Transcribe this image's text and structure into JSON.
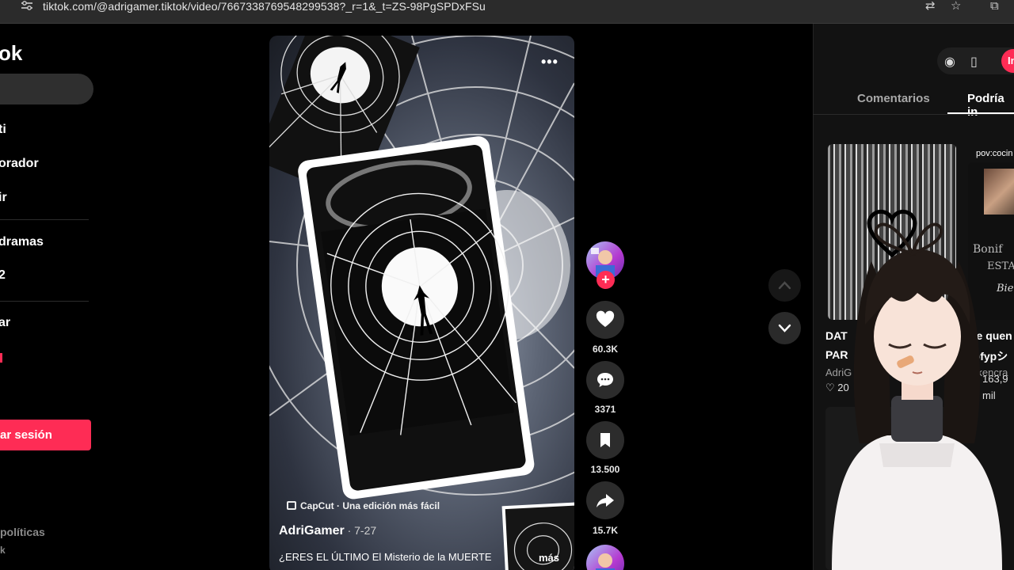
{
  "browser": {
    "url": "tiktok.com/@adrigamer.tiktok/video/7667338769548299538?_r=1&_t=ZS-98PgSPDxFSu"
  },
  "sidebar": {
    "logo_text": "ok",
    "nav_items": [
      "ti",
      "orador",
      "ir",
      "dramas",
      "2",
      "ar"
    ],
    "login_button": "ar sesión",
    "footer_text": "políticas",
    "footer_text2": "k"
  },
  "video": {
    "capcut_label": "CapCut · Una edición más fácil",
    "author": "AdriGamer",
    "date": " · 7-27",
    "caption": "¿ERES EL ÚLTIMO El Misterio de la MUERTE",
    "more_label": "más",
    "more_options": "•••"
  },
  "actions": {
    "likes": "60.3K",
    "comments": "3371",
    "saves": "13.500",
    "shares": "15.7K"
  },
  "right_panel": {
    "tab_comments": "Comentarios",
    "tab_suggested": "Podría in",
    "login_short": "In",
    "card1_title_a": "DAT",
    "card1_title_b": "PAR",
    "card1_author": "AdriG",
    "card1_likes": "20",
    "card2_top": "pov:cocin",
    "card2_overlay_a": "Bonif",
    "card2_overlay_b": "ESTA",
    "card2_overlay_c": "Bie",
    "card2_title_a": "ne quen",
    "card2_title_b": "fpfypシ",
    "card2_author": "sikencra",
    "card2_likes": "163,9",
    "card2_likes_unit": "mil"
  },
  "colors": {
    "brand_red": "#fe2c55",
    "background": "#000000",
    "panel": "#121212"
  }
}
